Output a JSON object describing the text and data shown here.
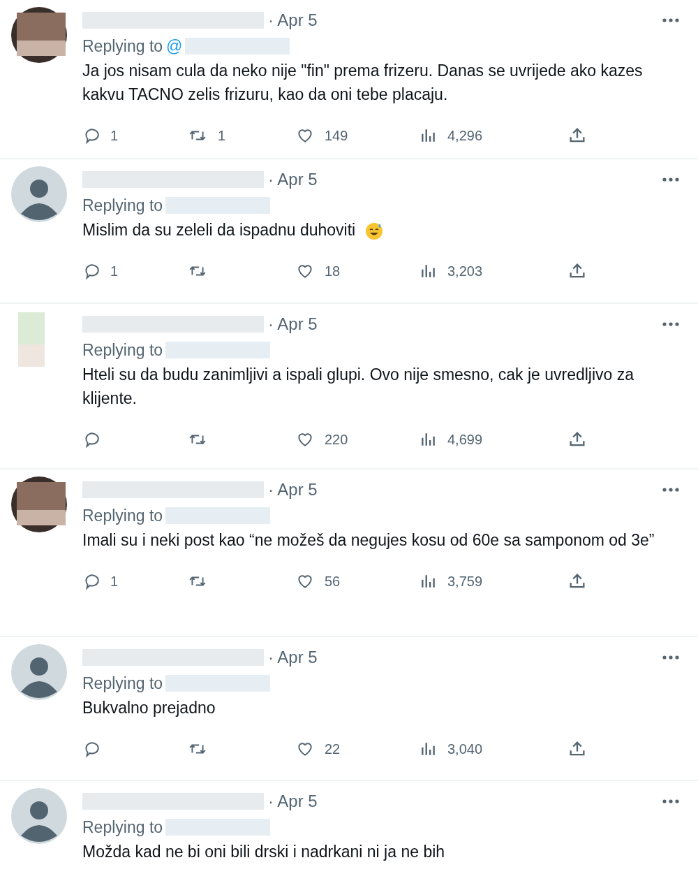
{
  "replies": [
    {
      "avatar": {
        "kind": "blurred-photo"
      },
      "date": "· Apr 5",
      "replying_to": "Replying to",
      "handle_prefix": "@",
      "text": "Ja jos nisam cula da neko nije \"fin\" prema frizeru. Danas se uvrijede ako kazes kakvu TACNO zelis frizuru, kao da oni tebe placaju.",
      "emoji": false,
      "actions": {
        "replies": "1",
        "retweets": "1",
        "likes": "149",
        "views": "4,296"
      }
    },
    {
      "avatar": {
        "kind": "default"
      },
      "date": "· Apr 5",
      "replying_to": "Replying to",
      "text": "Mislim da su zeleli da ispadnu duhoviti",
      "emoji": true,
      "actions": {
        "replies": "1",
        "likes": "18",
        "views": "3,203"
      }
    },
    {
      "avatar": {
        "kind": "blurred-light"
      },
      "date": "· Apr 5",
      "replying_to": "Replying to",
      "text": "Hteli su da budu zanimljivi a ispali glupi. Ovo nije smesno, cak je uvredljivo za klijente.",
      "emoji": false,
      "actions": {
        "likes": "220",
        "views": "4,699"
      }
    },
    {
      "avatar": {
        "kind": "blurred-photo"
      },
      "date": "· Apr 5",
      "replying_to": "Replying to",
      "text": "Imali su i neki post kao “ne možeš da negujes kosu od 60e sa samponom od 3e”",
      "emoji": false,
      "actions": {
        "replies": "1",
        "likes": "56",
        "views": "3,759"
      }
    },
    {
      "avatar": {
        "kind": "default"
      },
      "date": "· Apr 5",
      "replying_to": "Replying to",
      "text": "Bukvalno prejadno",
      "emoji": false,
      "actions": {
        "likes": "22",
        "views": "3,040"
      }
    },
    {
      "avatar": {
        "kind": "default"
      },
      "date": "· Apr 5",
      "replying_to": "Replying to",
      "text": "Možda kad ne bi oni bili drski i nadrkani ni ja ne bih",
      "emoji": false
    }
  ]
}
